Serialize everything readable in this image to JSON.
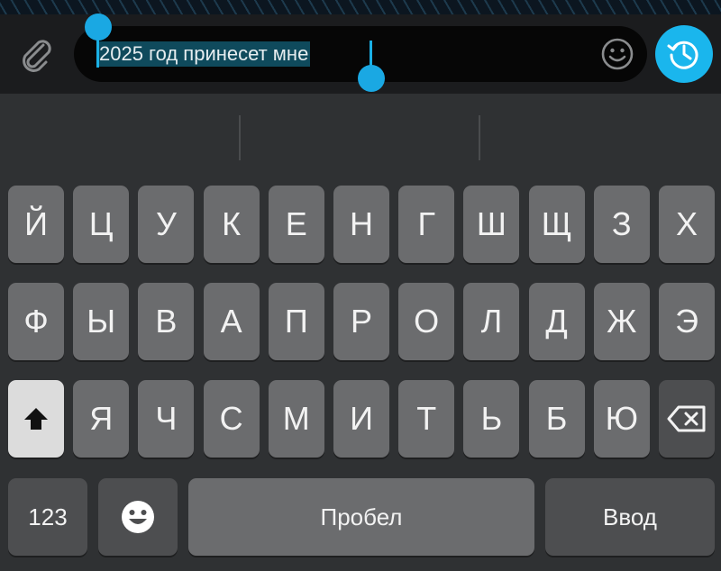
{
  "input": {
    "text": "2025 год принесет мне"
  },
  "keyboard": {
    "row1": [
      "Й",
      "Ц",
      "У",
      "К",
      "Е",
      "Н",
      "Г",
      "Ш",
      "Щ",
      "З",
      "Х"
    ],
    "row2": [
      "Ф",
      "Ы",
      "В",
      "А",
      "П",
      "Р",
      "О",
      "Л",
      "Д",
      "Ж",
      "Э"
    ],
    "row3": [
      "Я",
      "Ч",
      "С",
      "М",
      "И",
      "Т",
      "Ь",
      "Б",
      "Ю"
    ],
    "numbers_label": "123",
    "space_label": "Пробел",
    "enter_label": "Ввод"
  },
  "colors": {
    "accent": "#1ab6ed",
    "selection": "#0f4a5c"
  }
}
